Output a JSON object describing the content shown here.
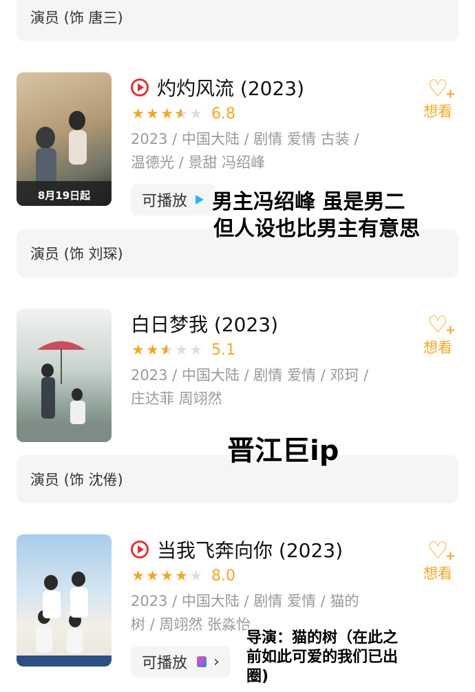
{
  "roles": [
    "演员 (饰 唐三)",
    "演员 (饰 刘琛)",
    "演员 (饰 沈倦)"
  ],
  "movies": [
    {
      "title": "灼灼风流 (2023)",
      "score": "6.8",
      "stars_value": 3.5,
      "meta": "2023 / 中国大陆 / 剧情 爱情 古装 / 温德光 / 景甜 冯绍峰",
      "play_label": "可播放",
      "want_label": "想看",
      "poster_text": "8月19日起",
      "poster_colors": [
        "#c9b18f",
        "#6a7a66",
        "#2f2d2a"
      ]
    },
    {
      "title": "白日梦我 (2023)",
      "score": "5.1",
      "stars_value": 2.5,
      "meta": "2023 / 中国大陆 / 剧情 爱情 / 邓珂 / 庄达菲 周翊然",
      "want_label": "想看",
      "poster_colors": [
        "#e9ecea",
        "#9fb2a7",
        "#5f6e66"
      ]
    },
    {
      "title": "当我飞奔向你 (2023)",
      "score": "8.0",
      "stars_value": 4,
      "meta": "2023 / 中国大陆 / 剧情 爱情 / 猫的树 / 周翊然 张淼怡",
      "play_label": "可播放",
      "want_label": "想看",
      "poster_colors": [
        "#b9d8ef",
        "#f2eee5",
        "#4c6fa3"
      ]
    }
  ],
  "captions": {
    "c1": "男主冯绍峰 虽是男二",
    "c2": "但人设也比男主有意思",
    "c3": "晋江巨ip",
    "c4": "导演：猫的树（在此之",
    "c5": "前如此可爱的我们已出",
    "c6": "圈)"
  },
  "colors": {
    "accent": "#f5a623",
    "play_red": "#e0323a"
  }
}
